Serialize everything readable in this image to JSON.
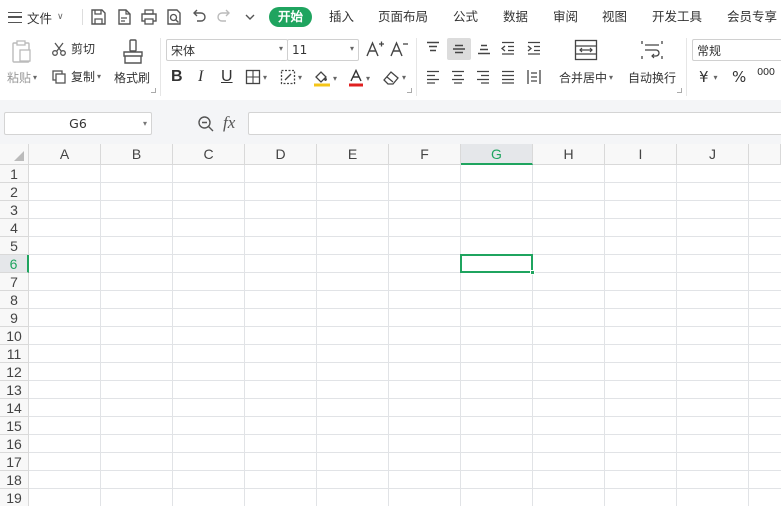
{
  "menu": {
    "file_label": "文件",
    "tabs": [
      "开始",
      "插入",
      "页面布局",
      "公式",
      "数据",
      "审阅",
      "视图",
      "开发工具",
      "会员专享"
    ],
    "active_tab": "开始"
  },
  "ribbon": {
    "paste_label": "粘贴",
    "cut_label": "剪切",
    "copy_label": "复制",
    "format_painter_label": "格式刷",
    "font_name": "宋体",
    "font_size": "11",
    "merge_label": "合并居中",
    "wrap_label": "自动换行",
    "number_format": "常规",
    "currency_symbol": "¥",
    "percent_symbol": "%",
    "thousands_symbol": "000"
  },
  "formula_bar": {
    "name_box": "G6",
    "fx_label": "fx",
    "formula": ""
  },
  "sheet": {
    "columns": [
      "A",
      "B",
      "C",
      "D",
      "E",
      "F",
      "G",
      "H",
      "I",
      "J"
    ],
    "rows": [
      "1",
      "2",
      "3",
      "4",
      "5",
      "6",
      "7",
      "8",
      "9",
      "10",
      "11",
      "12",
      "13",
      "14",
      "15",
      "16",
      "17",
      "18",
      "19"
    ],
    "selected_column": "G",
    "selected_row": "6",
    "accent_color": "#1fa45f"
  }
}
